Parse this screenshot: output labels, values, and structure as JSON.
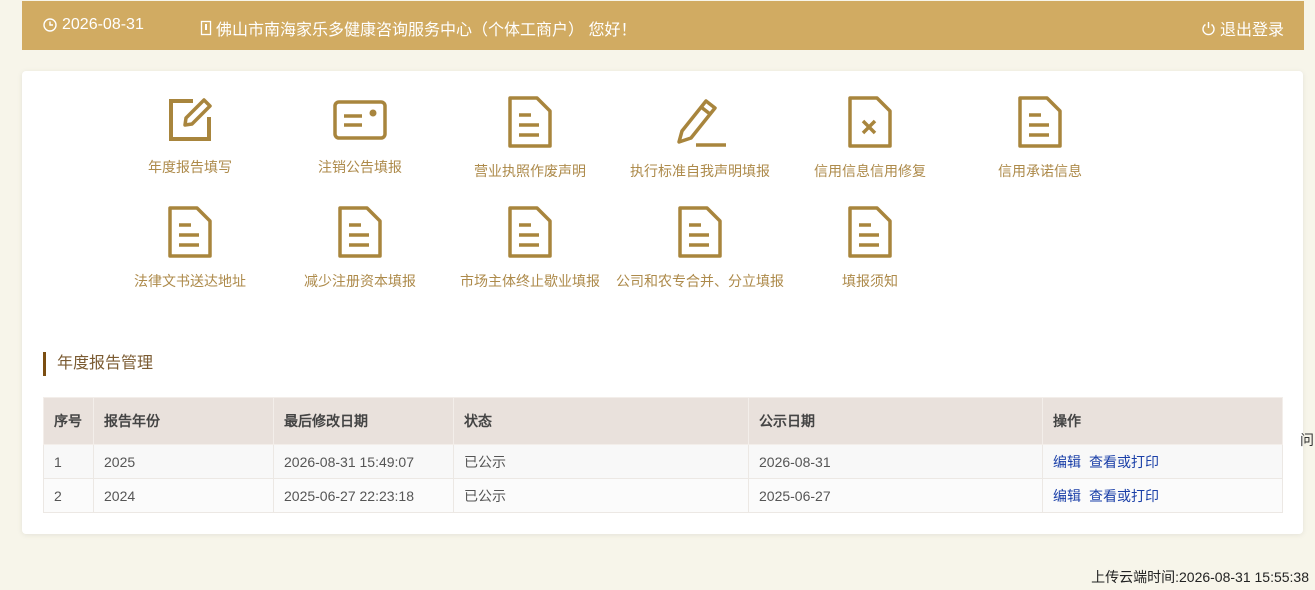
{
  "header": {
    "date": "2026-08-31",
    "greeting": "佛山市南海家乐多健康咨询服务中心（个体工商户） 您好！",
    "logout": "退出登录"
  },
  "tiles": [
    {
      "label": "年度报告填写",
      "icon": "edit-icon"
    },
    {
      "label": "注销公告填报",
      "icon": "card-icon"
    },
    {
      "label": "营业执照作废声明",
      "icon": "document-icon"
    },
    {
      "label": "执行标准自我声明填报",
      "icon": "pencil-icon"
    },
    {
      "label": "信用信息信用修复",
      "icon": "document-x-icon"
    },
    {
      "label": "信用承诺信息",
      "icon": "document-icon"
    },
    {
      "label": "法律文书送达地址",
      "icon": "document-icon"
    },
    {
      "label": "减少注册资本填报",
      "icon": "document-icon"
    },
    {
      "label": "市场主体终止歇业填报",
      "icon": "document-icon"
    },
    {
      "label": "公司和农专合并、分立填报",
      "icon": "document-icon"
    },
    {
      "label": "填报须知",
      "icon": "document-icon"
    }
  ],
  "section": {
    "title": "年度报告管理"
  },
  "table": {
    "headers": [
      "序号",
      "报告年份",
      "最后修改日期",
      "状态",
      "公示日期",
      "操作"
    ],
    "rows": [
      {
        "no": "1",
        "year": "2025",
        "modified": "2026-08-31 15:49:07",
        "status": "已公示",
        "publish": "2026-08-31",
        "edit": "编辑",
        "view": "查看或打印"
      },
      {
        "no": "2",
        "year": "2024",
        "modified": "2025-06-27 22:23:18",
        "status": "已公示",
        "publish": "2025-06-27",
        "edit": "编辑",
        "view": "查看或打印"
      }
    ]
  },
  "side_char": "问",
  "upload_time": "上传云端时间:2026-08-31 15:55:38",
  "colors": {
    "header_bg": "#d1ab62",
    "icon": "#a8853d",
    "label": "#ad8a4a",
    "link": "#1a3fa8"
  }
}
